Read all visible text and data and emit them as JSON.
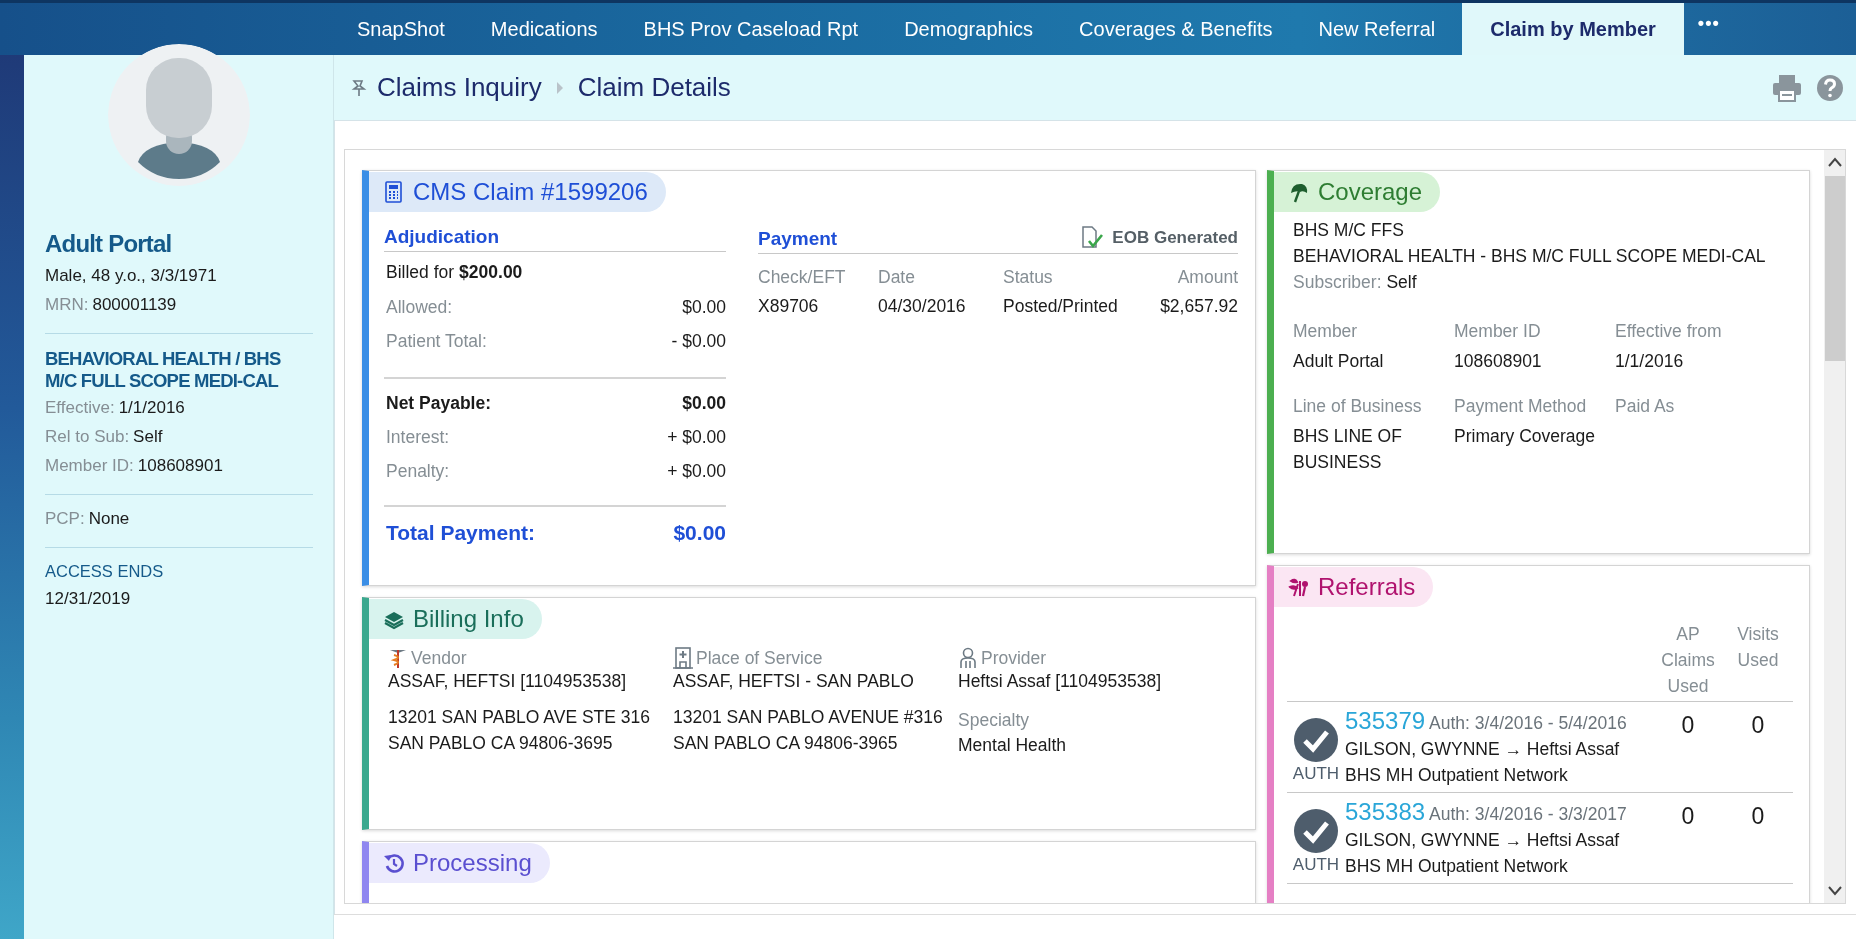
{
  "tabs": [
    {
      "label": "SnapShot",
      "selected": false
    },
    {
      "label": "Medications",
      "selected": false
    },
    {
      "label": "BHS Prov Caseload Rpt",
      "selected": false
    },
    {
      "label": "Demographics",
      "selected": false
    },
    {
      "label": "Coverages & Benefits",
      "selected": false
    },
    {
      "label": "New Referral",
      "selected": false
    },
    {
      "label": "Claim by Member",
      "selected": true
    }
  ],
  "more_tabs": "•••",
  "sidebar": {
    "name": "Adult Portal",
    "demographics": "Male, 48 y.o., 3/3/1971",
    "mrn": {
      "label": "MRN:",
      "value": "800001139"
    },
    "plan": "BEHAVIORAL HEALTH / BHS M/C FULL SCOPE MEDI-CAL",
    "plan_fields": [
      {
        "label": "Effective:",
        "value": "1/1/2016"
      },
      {
        "label": "Rel to Sub:",
        "value": "Self"
      },
      {
        "label": "Member ID:",
        "value": "108608901"
      }
    ],
    "pcp": {
      "label": "PCP:",
      "value": "None"
    },
    "access": {
      "label": "ACCESS ENDS",
      "value": "12/31/2019"
    }
  },
  "breadcrumb": [
    "Claims Inquiry",
    "Claim Details"
  ],
  "claim": {
    "title": "CMS Claim #1599206",
    "adjudication": {
      "title": "Adjudication",
      "billed_label": "Billed for",
      "billed_amount": "$200.00",
      "groups": [
        [
          {
            "label": "Allowed:",
            "value": "$0.00",
            "kind": "plain"
          },
          {
            "label": "Patient Total:",
            "value": "- $0.00",
            "kind": "plain"
          }
        ],
        [
          {
            "label": "Net Payable:",
            "value": "$0.00",
            "kind": "bold"
          },
          {
            "label": "Interest:",
            "value": "+ $0.00",
            "kind": "plain"
          },
          {
            "label": "Penalty:",
            "value": "+ $0.00",
            "kind": "plain"
          }
        ]
      ],
      "total": {
        "label": "Total Payment:",
        "value": "$0.00"
      }
    },
    "payment": {
      "title": "Payment",
      "eob": "EOB Generated",
      "columns": [
        "Check/EFT",
        "Date",
        "Status",
        "Amount"
      ],
      "row": [
        "X89706",
        "04/30/2016",
        "Posted/Printed",
        "$2,657.92"
      ]
    }
  },
  "billing": {
    "title": "Billing Info",
    "columns": [
      {
        "kind": "vendor",
        "label": "Vendor",
        "name": "ASSAF, HEFTSI [1104953538]",
        "address": [
          "13201 SAN PABLO AVE STE 316",
          "SAN PABLO CA 94806-3695"
        ]
      },
      {
        "kind": "place",
        "label": "Place of Service",
        "name": "ASSAF, HEFTSI - SAN PABLO",
        "address": [
          "13201 SAN PABLO AVENUE #316",
          "SAN PABLO CA 94806-3965"
        ]
      },
      {
        "kind": "provider",
        "label": "Provider",
        "name": "Heftsi Assaf [1104953538]",
        "specialty": {
          "label": "Specialty",
          "value": "Mental Health"
        }
      }
    ]
  },
  "processing": {
    "title": "Processing"
  },
  "coverage": {
    "title": "Coverage",
    "plan_code": "BHS M/C FFS",
    "plan_name": "BEHAVIORAL HEALTH - BHS M/C FULL SCOPE MEDI-CAL",
    "subscriber": {
      "label": "Subscriber:",
      "value": "Self"
    },
    "fields": [
      {
        "label": "Member",
        "value": "Adult Portal"
      },
      {
        "label": "Member ID",
        "value": "108608901"
      },
      {
        "label": "Effective from",
        "value": "1/1/2016"
      },
      {
        "label": "Line of Business",
        "value": "BHS LINE OF BUSINESS"
      },
      {
        "label": "Payment Method",
        "value": "Primary Coverage"
      },
      {
        "label": "Paid As"
      }
    ]
  },
  "referrals": {
    "title": "Referrals",
    "columns": [
      "AP Claims Used",
      "Visits Used"
    ],
    "rows": [
      {
        "number": "535379",
        "auth": "Auth: 3/4/2016 - 5/4/2016",
        "route": "GILSON, GWYNNE → Heftsi Assaf",
        "network": "BHS MH Outpatient Network",
        "status": "AUTH",
        "ap_claims": "0",
        "visits": "0"
      },
      {
        "number": "535383",
        "auth": "Auth: 3/4/2016 - 3/3/2017",
        "route": "GILSON, GWYNNE → Heftsi Assaf",
        "network": "BHS MH Outpatient Network",
        "status": "AUTH",
        "ap_claims": "0",
        "visits": "0"
      }
    ]
  }
}
